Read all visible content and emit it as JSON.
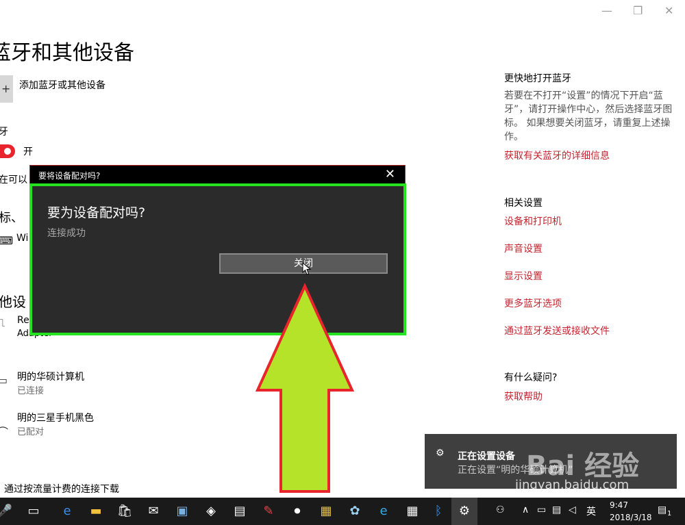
{
  "window": {
    "minimize": "—",
    "restore": "❐",
    "close": "✕"
  },
  "page": {
    "title": "蓝牙和其他设备",
    "add_device": {
      "icon": "plus",
      "label": "添加蓝牙或其他设备"
    },
    "bluetooth": {
      "label": "牙",
      "toggle_state": "on",
      "toggle_text": "开"
    },
    "clip_text": "在可以",
    "section_mouse": "标、",
    "keyboard": {
      "icon": "keyboard-icon",
      "name": "Wi"
    },
    "section_other": "他设",
    "devices": [
      {
        "icon": "adapter-icon",
        "name": "Re",
        "status": "Adapter"
      },
      {
        "icon": "laptop-icon",
        "name": "明的华硕计算机",
        "status": "已连接"
      },
      {
        "icon": "headphone-icon",
        "name": "明的三星手机黑色",
        "status": "已配对"
      }
    ],
    "metered": "通过按流量计费的连接下载"
  },
  "right": {
    "quick_title": "更快地打开蓝牙",
    "quick_text": "若要在不打开“设置”的情况下开启“蓝牙”，请打开操作中心，然后选择蓝牙图标。 如果想要关闭蓝牙，请重复上述操作。",
    "quick_link": "获取有关蓝牙的详细信息",
    "related_title": "相关设置",
    "related_links": [
      "设备和打印机",
      "声音设置",
      "显示设置",
      "更多蓝牙选项",
      "通过蓝牙发送或接收文件"
    ],
    "help_title": "有什么疑问?",
    "help_link": "获取帮助"
  },
  "dialog": {
    "bar_title": "要将设备配对吗?",
    "heading": "要为设备配对吗?",
    "subtext": "连接成功",
    "button": "关闭"
  },
  "toast": {
    "title": "正在设置设备",
    "text": "正在设置“明的华硕计算机”"
  },
  "watermark": {
    "logo": "Bai 经验",
    "url": "jingyan.baidu.com"
  },
  "annotation": {
    "fill": "#b5e32a",
    "stroke": "#e8252c",
    "box_color": "#26e320"
  },
  "taskbar": {
    "apps": [
      "mic",
      "task-view",
      "edge",
      "file-explorer",
      "store",
      "mail",
      "app1",
      "app2",
      "app3",
      "app4",
      "app5",
      "app6",
      "app7",
      "ie",
      "calculator",
      "bluetooth",
      "settings"
    ],
    "ime": "英",
    "time": "9:47",
    "date": "2018/3/18",
    "notification_count": "1"
  }
}
